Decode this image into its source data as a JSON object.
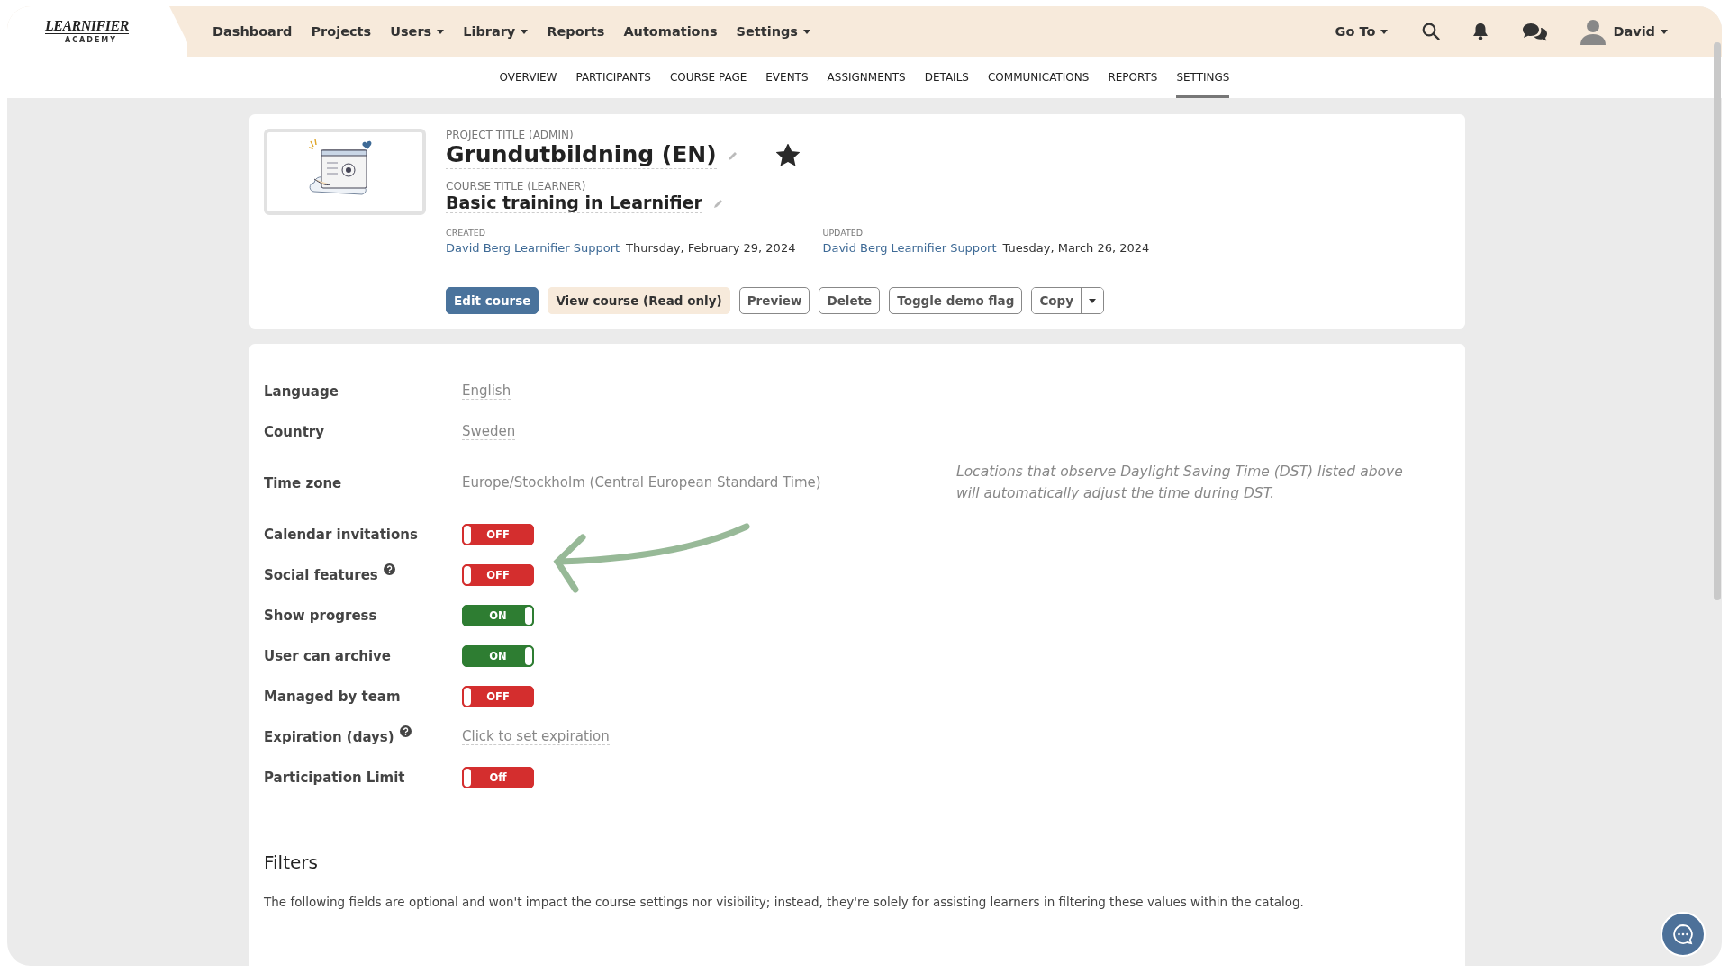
{
  "logo": {
    "name": "LEARNIFIER",
    "tagline": "ACADEMY"
  },
  "nav": {
    "items": [
      {
        "label": "Dashboard",
        "dropdown": false
      },
      {
        "label": "Projects",
        "dropdown": false
      },
      {
        "label": "Users",
        "dropdown": true
      },
      {
        "label": "Library",
        "dropdown": true
      },
      {
        "label": "Reports",
        "dropdown": false
      },
      {
        "label": "Automations",
        "dropdown": false
      },
      {
        "label": "Settings",
        "dropdown": true
      }
    ],
    "goto": "Go To",
    "user": "David"
  },
  "subnav": [
    {
      "label": "OVERVIEW",
      "selected": false
    },
    {
      "label": "PARTICIPANTS",
      "selected": false
    },
    {
      "label": "COURSE PAGE",
      "selected": false
    },
    {
      "label": "EVENTS",
      "selected": false
    },
    {
      "label": "ASSIGNMENTS",
      "selected": false
    },
    {
      "label": "DETAILS",
      "selected": false
    },
    {
      "label": "COMMUNICATIONS",
      "selected": false
    },
    {
      "label": "REPORTS",
      "selected": false
    },
    {
      "label": "SETTINGS",
      "selected": true
    }
  ],
  "project": {
    "admin_label": "PROJECT TITLE (ADMIN)",
    "title": "Grundutbildning (EN)",
    "starred": true,
    "learner_label": "COURSE TITLE (LEARNER)",
    "course_title": "Basic training in Learnifier",
    "created": {
      "label": "CREATED",
      "author": "David Berg Learnifier Support",
      "date": "Thursday, February 29, 2024"
    },
    "updated": {
      "label": "UPDATED",
      "author": "David Berg Learnifier Support",
      "date": "Tuesday, March 26, 2024"
    },
    "buttons": [
      {
        "label": "Edit course",
        "kind": "primary"
      },
      {
        "label": "View course (Read only)",
        "kind": "soft"
      },
      {
        "label": "Preview",
        "kind": "outline"
      },
      {
        "label": "Delete",
        "kind": "outline"
      },
      {
        "label": "Toggle demo flag",
        "kind": "outline"
      },
      {
        "label": "Copy",
        "kind": "split"
      }
    ]
  },
  "settings": {
    "rows": [
      {
        "label": "Language",
        "kind": "value",
        "value": "English",
        "help": false
      },
      {
        "label": "Country",
        "kind": "value",
        "value": "Sweden",
        "help": false
      },
      {
        "label": "Time zone",
        "kind": "value",
        "value": "Europe/Stockholm (Central European Standard Time)",
        "help": false
      },
      {
        "label": "Calendar invitations",
        "kind": "toggle",
        "on": false,
        "state_text": "OFF",
        "help": false
      },
      {
        "label": "Social features",
        "kind": "toggle",
        "on": false,
        "state_text": "OFF",
        "help": true
      },
      {
        "label": "Show progress",
        "kind": "toggle",
        "on": true,
        "state_text": "ON",
        "help": false
      },
      {
        "label": "User can archive",
        "kind": "toggle",
        "on": true,
        "state_text": "ON",
        "help": false
      },
      {
        "label": "Managed by team",
        "kind": "toggle",
        "on": false,
        "state_text": "OFF",
        "help": false
      },
      {
        "label": "Expiration (days)",
        "kind": "value",
        "value": "Click to set expiration",
        "help": true
      },
      {
        "label": "Participation Limit",
        "kind": "toggle",
        "on": false,
        "state_text": "Off",
        "help": false
      }
    ],
    "note": "Locations that observe Daylight Saving Time (DST) listed above will automatically adjust the time during DST."
  },
  "filters": {
    "title": "Filters",
    "text": "The following fields are optional and won't impact the course settings nor visibility; instead, they're solely for assisting learners in filtering these values within the catalog."
  }
}
